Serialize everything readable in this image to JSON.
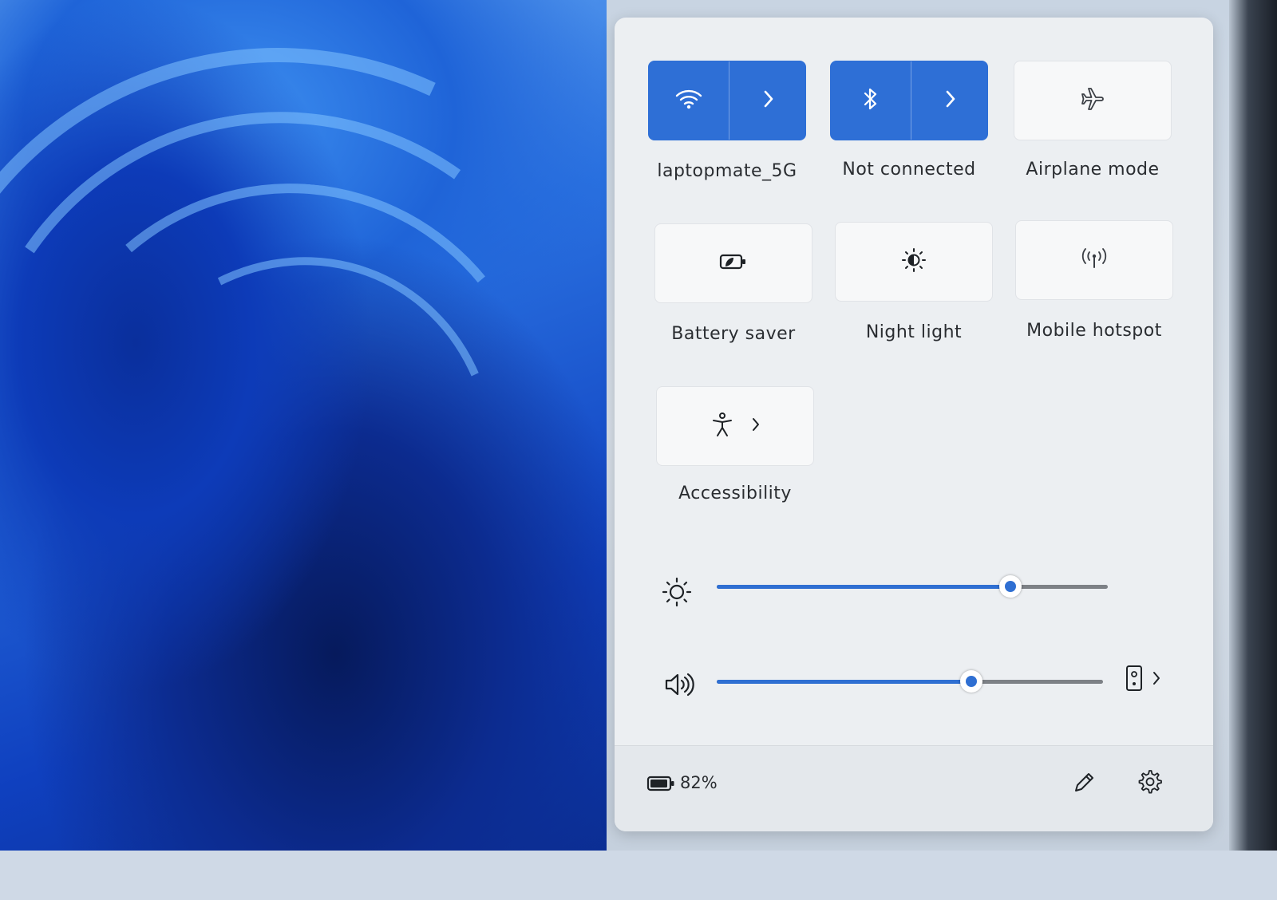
{
  "quick_settings": {
    "wifi": {
      "label": "laptopmate_5G",
      "icon": "wifi-icon",
      "state": "on"
    },
    "bluetooth": {
      "label": "Not connected",
      "icon": "bluetooth-icon",
      "state": "on"
    },
    "airplane": {
      "label": "Airplane mode",
      "icon": "airplane-icon",
      "state": "off"
    },
    "battery_saver": {
      "label": "Battery saver",
      "icon": "battery-saver-icon",
      "state": "off"
    },
    "night_light": {
      "label": "Night light",
      "icon": "night-light-icon",
      "state": "off"
    },
    "hotspot": {
      "label": "Mobile hotspot",
      "icon": "hotspot-icon",
      "state": "off"
    },
    "accessibility": {
      "label": "Accessibility",
      "icon": "accessibility-icon",
      "state": "off"
    }
  },
  "sliders": {
    "brightness": {
      "icon": "brightness-icon",
      "level": 0.75
    },
    "volume": {
      "icon": "speaker-icon",
      "level": 0.66
    }
  },
  "footer": {
    "battery_percent": "82%",
    "battery_icon": "battery-icon",
    "edit_icon": "pencil-icon",
    "settings_icon": "gear-icon"
  },
  "colors": {
    "accent": "#2e6fd6",
    "panel_bg": "#eceff2",
    "text": "#2a2d31"
  }
}
